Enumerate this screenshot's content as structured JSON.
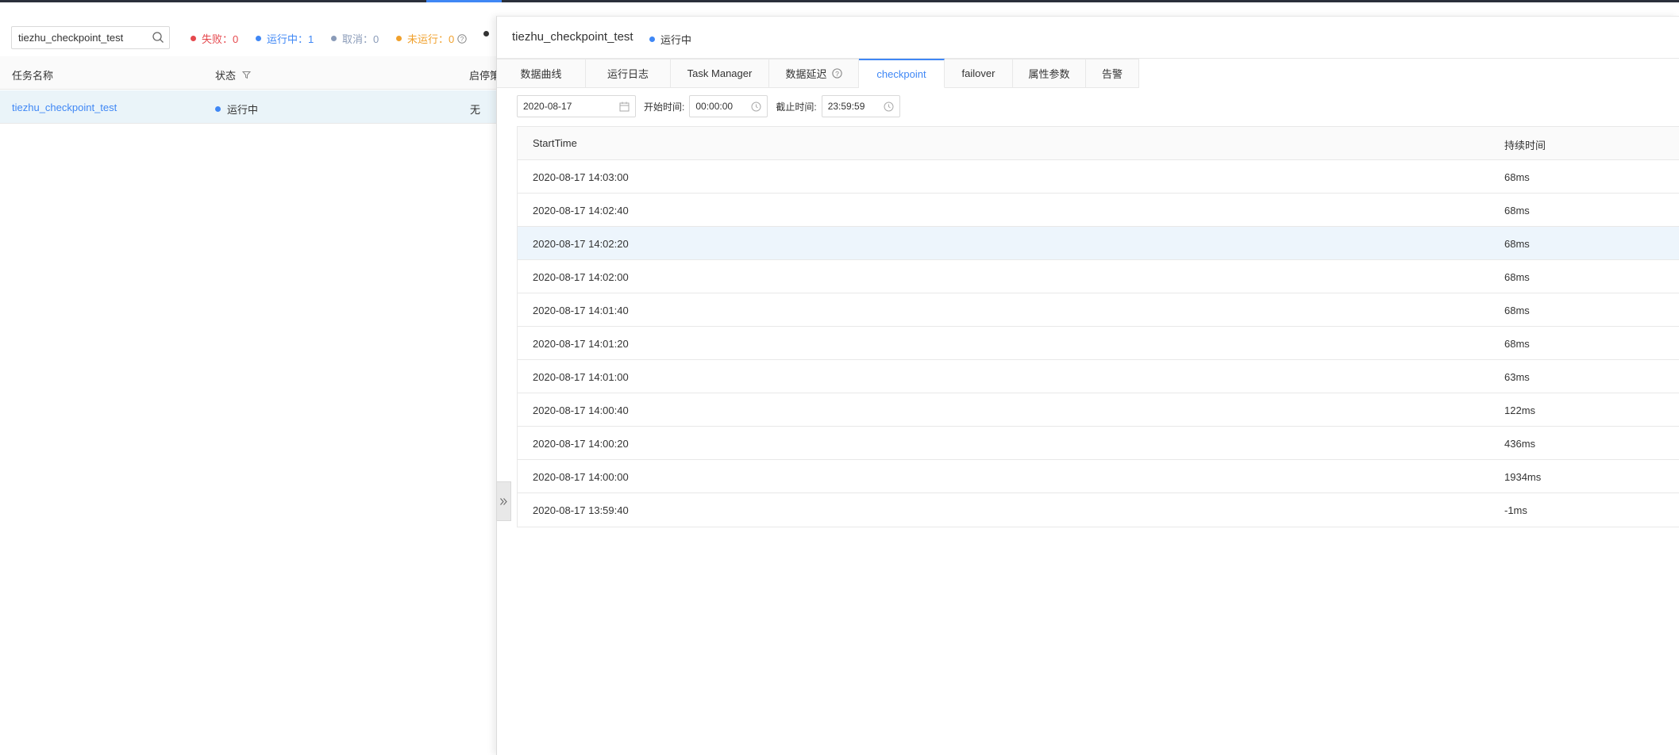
{
  "colors": {
    "accent": "#3f87f5",
    "failed": "#e5484d",
    "running": "#3f87f5",
    "cancelled": "#8a9bb8",
    "not_run": "#f0a02c",
    "other": "#333333"
  },
  "left": {
    "search": {
      "value": "tiezhu_checkpoint_test",
      "icon": "search-icon"
    },
    "stats": [
      {
        "label": "失败：0",
        "color": "#e5484d"
      },
      {
        "label": "运行中：1",
        "color": "#3f87f5"
      },
      {
        "label": "取消：0",
        "color": "#8a9bb8"
      },
      {
        "label": "未运行：0",
        "color": "#f0a02c"
      }
    ],
    "table": {
      "headers": [
        "任务名称",
        "状态",
        "启停策"
      ],
      "rows": [
        {
          "name": "tiezhu_checkpoint_test",
          "status": "运行中",
          "policy": "无"
        }
      ]
    }
  },
  "panel": {
    "title": "tiezhu_checkpoint_test",
    "status": "运行中",
    "tabs": [
      "数据曲线",
      "运行日志",
      "Task Manager",
      "数据延迟",
      "checkpoint",
      "failover",
      "属性参数",
      "告警"
    ],
    "active_tab": "checkpoint",
    "filters": {
      "date": "2020-08-17",
      "start_label": "开始时间:",
      "start_time": "00:00:00",
      "end_label": "截止时间:",
      "end_time": "23:59:59"
    },
    "table": {
      "headers": [
        "StartTime",
        "持续时间"
      ],
      "rows": [
        {
          "start": "2020-08-17 14:03:00",
          "duration": "68ms"
        },
        {
          "start": "2020-08-17 14:02:40",
          "duration": "68ms"
        },
        {
          "start": "2020-08-17 14:02:20",
          "duration": "68ms"
        },
        {
          "start": "2020-08-17 14:02:00",
          "duration": "68ms"
        },
        {
          "start": "2020-08-17 14:01:40",
          "duration": "68ms"
        },
        {
          "start": "2020-08-17 14:01:20",
          "duration": "68ms"
        },
        {
          "start": "2020-08-17 14:01:00",
          "duration": "63ms"
        },
        {
          "start": "2020-08-17 14:00:40",
          "duration": "122ms"
        },
        {
          "start": "2020-08-17 14:00:20",
          "duration": "436ms"
        },
        {
          "start": "2020-08-17 14:00:00",
          "duration": "1934ms"
        },
        {
          "start": "2020-08-17 13:59:40",
          "duration": "-1ms"
        }
      ]
    }
  }
}
